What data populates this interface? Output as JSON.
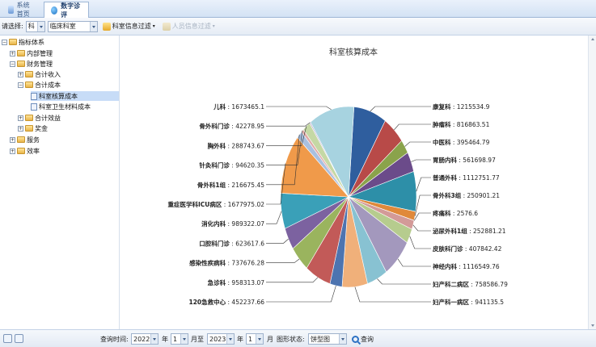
{
  "tabs": [
    {
      "label": "系统首页",
      "active": false
    },
    {
      "label": "数字诊评",
      "active": true
    }
  ],
  "toolbar": {
    "select_label": "请选择:",
    "category_value": "科",
    "dept_value": "临床科室",
    "filter_button": "科室信息过滤",
    "staff_filter_button": "人员信息过滤"
  },
  "tree": [
    {
      "label": "指标体系",
      "level": 0,
      "expander": "−",
      "icon": "folder-icon"
    },
    {
      "label": "内部管理",
      "level": 1,
      "expander": "+",
      "icon": "folder-icon"
    },
    {
      "label": "财务管理",
      "level": 1,
      "expander": "−",
      "icon": "folder-icon"
    },
    {
      "label": "合计收入",
      "level": 2,
      "expander": "+",
      "icon": "folder-icon"
    },
    {
      "label": "合计成本",
      "level": 2,
      "expander": "−",
      "icon": "folder-icon"
    },
    {
      "label": "科室核算成本",
      "level": 3,
      "expander": "",
      "icon": "document-icon",
      "selected": true
    },
    {
      "label": "科室卫生材料成本",
      "level": 3,
      "expander": "",
      "icon": "document-icon"
    },
    {
      "label": "合计效益",
      "level": 2,
      "expander": "+",
      "icon": "folder-icon"
    },
    {
      "label": "奖金",
      "level": 2,
      "expander": "+",
      "icon": "folder-icon"
    },
    {
      "label": "服务",
      "level": 1,
      "expander": "+",
      "icon": "folder-icon"
    },
    {
      "label": "效率",
      "level": 1,
      "expander": "+",
      "icon": "folder-icon"
    }
  ],
  "chart_data": {
    "type": "pie",
    "title": "科室核算成本",
    "slices": [
      {
        "name": "康复科",
        "value": 1215534.9,
        "color": "#2f5e9e"
      },
      {
        "name": "肿瘤科",
        "value": 816863.51,
        "color": "#b84a48"
      },
      {
        "name": "中医科",
        "value": 395464.79,
        "color": "#8aa34b"
      },
      {
        "name": "胃肠内科",
        "value": 561698.97,
        "color": "#6b4b8a"
      },
      {
        "name": "普通外科",
        "value": 1112751.77,
        "color": "#2d8fa8"
      },
      {
        "name": "骨外科3组",
        "value": 250901.21,
        "color": "#e0893a"
      },
      {
        "name": "疼痛科",
        "value": 2576.6,
        "color": "#98b5d8"
      },
      {
        "name": "泌尿外科1组",
        "value": 252881.21,
        "color": "#d39a98"
      },
      {
        "name": "皮肤科门诊",
        "value": 407842.42,
        "color": "#b6cc8e"
      },
      {
        "name": "神经内科",
        "value": 1116549.76,
        "color": "#a398bd"
      },
      {
        "name": "妇产科二病区",
        "value": 758586.79,
        "color": "#88c2d2"
      },
      {
        "name": "妇产科一病区",
        "value": 941135.5,
        "color": "#f0b07a"
      },
      {
        "name": "120急救中心",
        "value": 452237.66,
        "color": "#4d74b0"
      },
      {
        "name": "急诊科",
        "value": 958313.07,
        "color": "#c25a58"
      },
      {
        "name": "感染性疾病科",
        "value": 737676.28,
        "color": "#9ab45e"
      },
      {
        "name": "口腔科门诊",
        "value": 623617.6,
        "color": "#7c62a0"
      },
      {
        "name": "消化内科",
        "value": 989322.07,
        "color": "#3aa0b8"
      },
      {
        "name": "重症医学科ICU病区",
        "value": 1677975.02,
        "color": "#f09a4a"
      },
      {
        "name": "骨外科1组",
        "value": 216675.45,
        "color": "#a9c0e0"
      },
      {
        "name": "针灸科门诊",
        "value": 94620.35,
        "color": "#e0aaa8"
      },
      {
        "name": "胸外科",
        "value": 288743.67,
        "color": "#c5d8a4"
      },
      {
        "name": "骨外科门诊",
        "value": 42278.95,
        "color": "#b8acd0"
      },
      {
        "name": "儿科",
        "value": 1673465.1,
        "color": "#a7d3e0"
      }
    ]
  },
  "bottom": {
    "query_time_label": "查询时间:",
    "start_year": "2022",
    "year_label": "年",
    "start_month": "1",
    "month_to_label": "月至",
    "end_year": "2023",
    "year_label2": "年",
    "end_month": "1",
    "month_label": "月",
    "chart_state_label": "图形状态:",
    "chart_state_value": "饼型图",
    "query_button": "查询"
  }
}
